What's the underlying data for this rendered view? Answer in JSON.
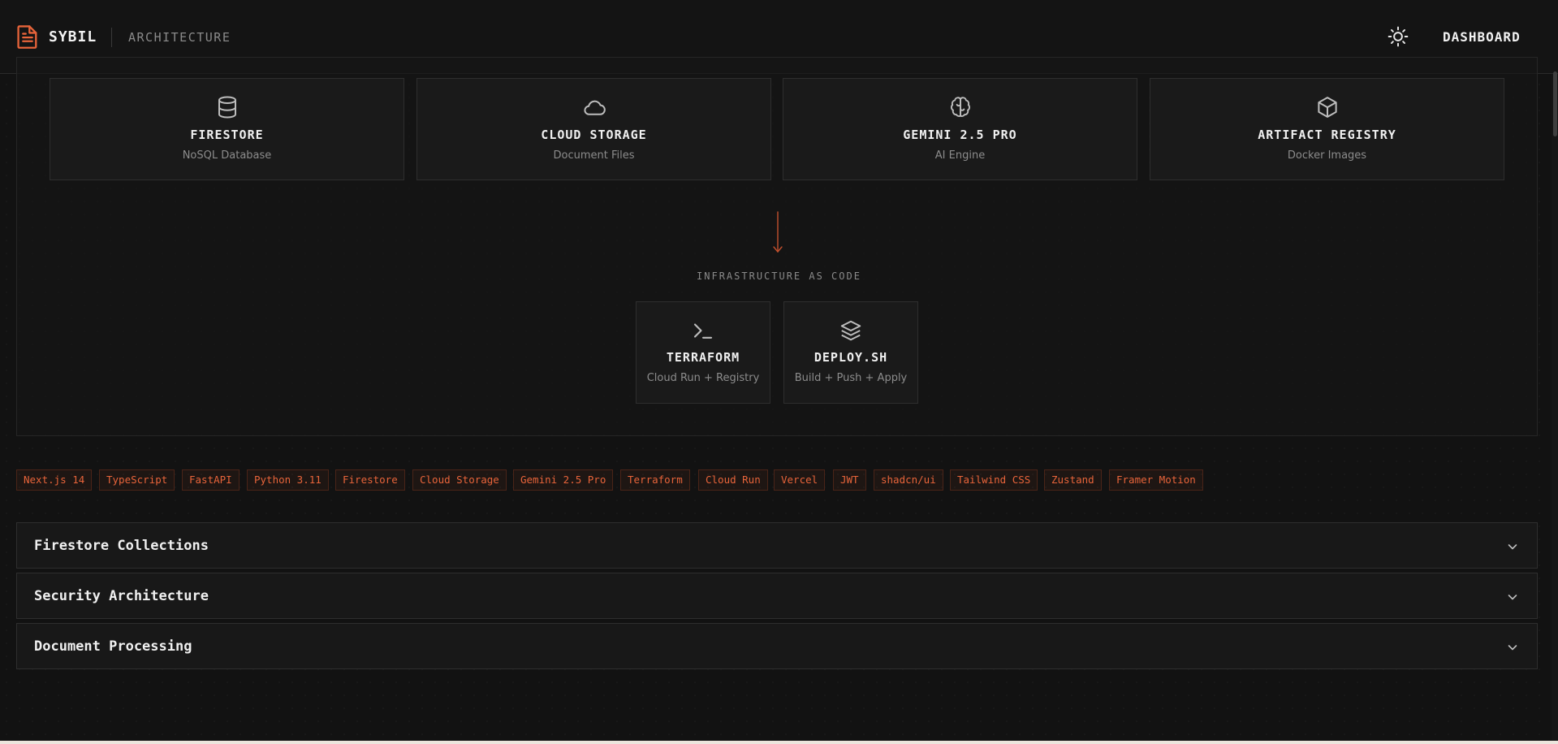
{
  "header": {
    "brand": "SYBIL",
    "section": "ARCHITECTURE",
    "theme_toggle_icon": "sun-icon",
    "dashboard_label": "DASHBOARD",
    "logo_icon": "document-icon"
  },
  "services": [
    {
      "title": "FIRESTORE",
      "subtitle": "NoSQL Database",
      "icon": "database-icon"
    },
    {
      "title": "CLOUD STORAGE",
      "subtitle": "Document Files",
      "icon": "cloud-icon"
    },
    {
      "title": "GEMINI 2.5 PRO",
      "subtitle": "AI Engine",
      "icon": "brain-icon"
    },
    {
      "title": "ARTIFACT REGISTRY",
      "subtitle": "Docker Images",
      "icon": "package-icon"
    }
  ],
  "iac": {
    "label": "INFRASTRUCTURE AS CODE",
    "cards": [
      {
        "title": "TERRAFORM",
        "subtitle": "Cloud Run + Registry",
        "icon": "terminal-icon"
      },
      {
        "title": "DEPLOY.SH",
        "subtitle": "Build + Push + Apply",
        "icon": "layers-icon"
      }
    ]
  },
  "tags": [
    "Next.js 14",
    "TypeScript",
    "FastAPI",
    "Python 3.11",
    "Firestore",
    "Cloud Storage",
    "Gemini 2.5 Pro",
    "Terraform",
    "Cloud Run",
    "Vercel",
    "JWT",
    "shadcn/ui",
    "Tailwind CSS",
    "Zustand",
    "Framer Motion"
  ],
  "accordions": [
    {
      "title": "Firestore Collections"
    },
    {
      "title": "Security Architecture"
    },
    {
      "title": "Document Processing"
    }
  ],
  "colors": {
    "accent": "#e8643a",
    "background": "#121212",
    "card": "#1a1a1a",
    "border": "#2e2e2e"
  }
}
